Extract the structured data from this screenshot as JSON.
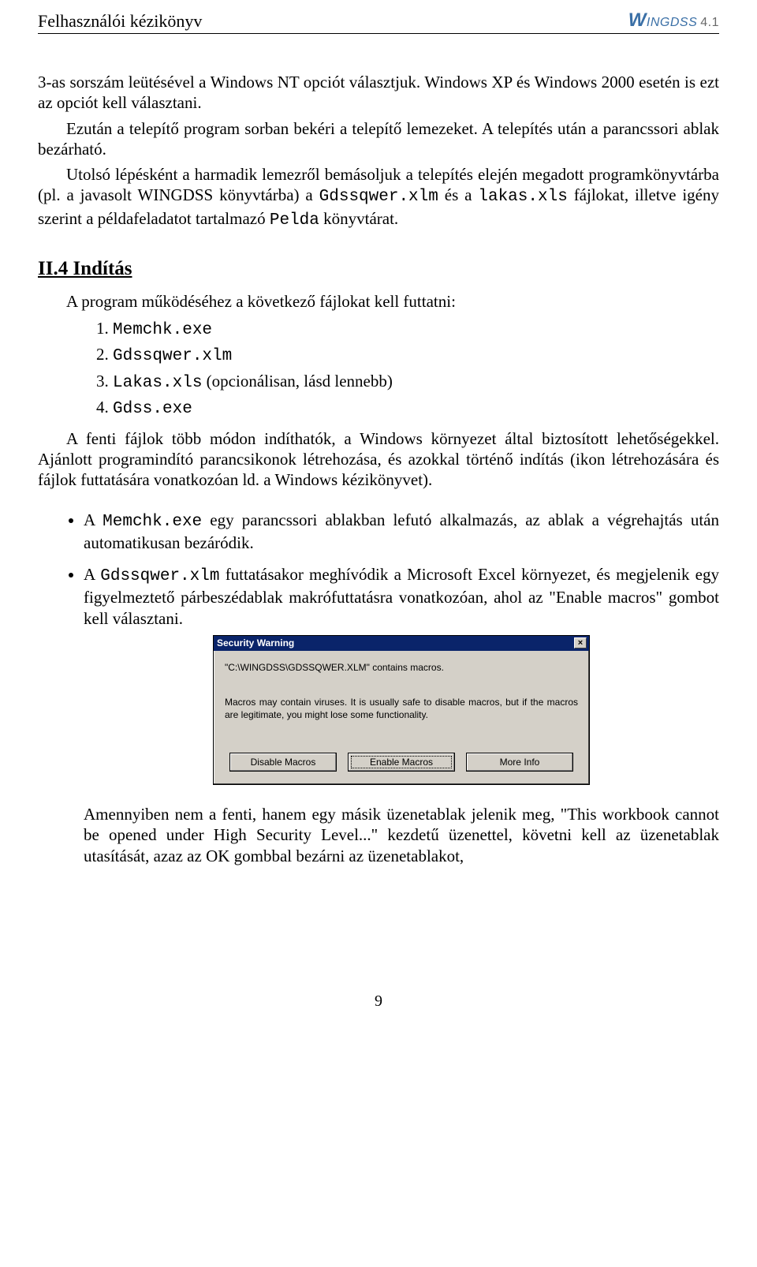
{
  "header": {
    "title": "Felhasználói kézikönyv",
    "logo_text": "INGDSS",
    "logo_prefix": "W",
    "logo_version": "4.1"
  },
  "body": {
    "p1": "3-as sorszám leütésével a Windows NT opciót választjuk. Windows XP és Windows 2000 esetén is ezt az opciót kell választani.",
    "p2": "Ezután a telepítő program sorban bekéri a telepítő lemezeket. A telepítés után a parancssori ablak bezárható.",
    "p3a": "Utolsó lépésként a harmadik lemezről bemásoljuk a telepítés elején megadott programkönyvtárba (pl. a javasolt WINGDSS könyvtárba) a ",
    "p3m1": "Gdssqwer.xlm",
    "p3b": " és a ",
    "p3m2": "lakas.xls",
    "p3c": " fájlokat, illetve igény szerint a példafeladatot tartalmazó ",
    "p3m3": "Pelda",
    "p3d": " könyvtárat.",
    "section_heading": "II.4  Indítás",
    "intro_list": "A program működéséhez a következő fájlokat kell futtatni:",
    "li1_n": "1. ",
    "li1_m": "Memchk.exe",
    "li2_n": "2. ",
    "li2_m": "Gdssqwer.xlm",
    "li3_n": "3. ",
    "li3_m": "Lakas.xls",
    "li3_t": " (opcionálisan, lásd lennebb)",
    "li4_n": "4. ",
    "li4_m": "Gdss.exe",
    "p4": "A fenti fájlok több módon indíthatók, a Windows környezet által biztosított lehetőségekkel. Ajánlott programindító parancsikonok létrehozása, és azokkal történő indítás (ikon létrehozására és fájlok futtatására vonatkozóan ld. a Windows kézikönyvet).",
    "b1a": "A ",
    "b1m": "Memchk.exe",
    "b1b": " egy parancssori ablakban lefutó alkalmazás, az ablak a végrehajtás után automatikusan bezáródik.",
    "b2a": "A ",
    "b2m": "Gdssqwer.xlm",
    "b2b": " futtatásakor meghívódik a Microsoft Excel környezet, és megjelenik egy figyelmeztető párbeszédablak makrófuttatásra vonatkozóan, ahol az \"Enable macros\" gombot kell választani.",
    "p5": "Amennyiben nem a fenti, hanem egy másik üzenetablak jelenik meg, \"This workbook cannot be opened under High Security Level...\" kezdetű üzenettel, követni kell az üzenetablak utasítását, azaz az OK gombbal bezárni az üzenetablakot,",
    "page_number": "9"
  },
  "dialog": {
    "title": "Security Warning",
    "msg1": "\"C:\\WINGDSS\\GDSSQWER.XLM\" contains macros.",
    "msg2": "Macros may contain viruses. It is usually safe to disable macros, but if the macros are legitimate, you might lose some functionality.",
    "btn_disable": "Disable Macros",
    "btn_enable": "Enable Macros",
    "btn_more": "More Info"
  }
}
